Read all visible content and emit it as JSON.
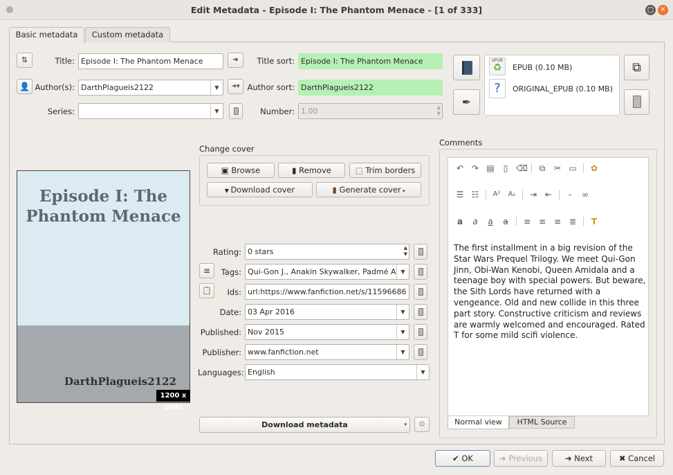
{
  "window": {
    "title": "Edit Metadata - Episode I: The Phantom Menace -  [1 of 333]"
  },
  "tabs": [
    {
      "label": "Basic metadata"
    },
    {
      "label": "Custom metadata"
    }
  ],
  "basic": {
    "title_label": "Title:",
    "title_value": "Episode I: The Phantom Menace",
    "title_sort_label": "Title sort:",
    "title_sort_value": "Episode I: The Phantom Menace",
    "author_label": "Author(s):",
    "author_value": "DarthPlagueis2122",
    "author_sort_label": "Author sort:",
    "author_sort_value": "DarthPlagueis2122",
    "series_label": "Series:",
    "series_value": "",
    "number_label": "Number:",
    "number_value": "1.00"
  },
  "formats": [
    {
      "name": "EPUB (0.10 MB)",
      "icon": "epub-icon"
    },
    {
      "name": "ORIGINAL_EPUB (0.10 MB)",
      "icon": "unknown-format-icon"
    }
  ],
  "cover": {
    "section_label": "Change cover",
    "browse": "Browse",
    "remove": "Remove",
    "trim": "Trim borders",
    "download": "Download cover",
    "generate": "Generate cover",
    "image_title": "Episode I: The Phantom Menace",
    "image_author": "DarthPlagueis2122",
    "dimensions": "1200 x 1600",
    "colors": {
      "top": "#dcebf2",
      "bottom": "#a3a9ac"
    }
  },
  "fields": {
    "rating_label": "Rating:",
    "rating_value": "0 stars",
    "tags_label": "Tags:",
    "tags_value": "Qui-Gon J., Anakin Skywalker, Padmé Amidala",
    "ids_label": "Ids:",
    "ids_value": "url:https://www.fanfiction.net/s/11596686",
    "date_label": "Date:",
    "date_value": "03 Apr 2016",
    "published_label": "Published:",
    "published_value": "Nov 2015",
    "publisher_label": "Publisher:",
    "publisher_value": "www.fanfiction.net",
    "languages_label": "Languages:",
    "languages_value": "English"
  },
  "download_metadata": "Download metadata",
  "comments": {
    "label": "Comments",
    "text": "The first installment in a big revision of the Star Wars Prequel Trilogy. We meet Qui-Gon Jinn, Obi-Wan Kenobi, Queen Amidala and a teenage boy with special powers. But beware, the Sith Lords have returned with a vengeance. Old and new collide in this three part story. Constructive criticism and reviews are warmly welcomed and encouraged. Rated T for some mild scifi violence.",
    "tab_normal": "Normal view",
    "tab_html": "HTML Source"
  },
  "footer": {
    "ok": "OK",
    "previous": "Previous",
    "next": "Next",
    "cancel": "Cancel"
  },
  "colors": {
    "green_field": "#b7f0b5",
    "close_button": "#e8772e"
  }
}
